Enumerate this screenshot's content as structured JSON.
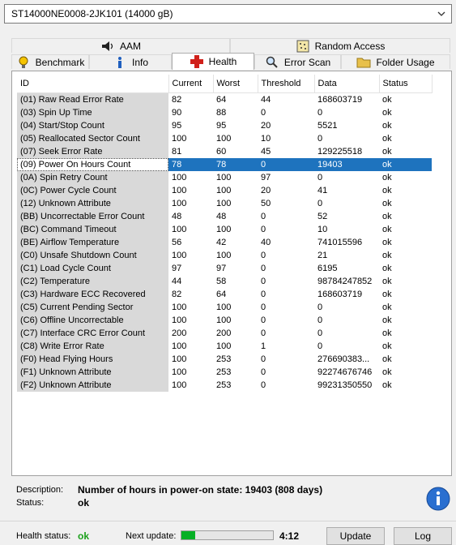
{
  "drive_select": {
    "value": "ST14000NE0008-2JK101 (14000 gB)"
  },
  "tabs_top": [
    {
      "label": "AAM",
      "icon": "speaker-icon"
    },
    {
      "label": "Random Access",
      "icon": "grid-icon"
    }
  ],
  "tabs_bottom": [
    {
      "label": "Benchmark",
      "icon": "lightbulb-icon"
    },
    {
      "label": "Info",
      "icon": "info-icon"
    },
    {
      "label": "Health",
      "icon": "red-cross-icon",
      "active": true
    },
    {
      "label": "Error Scan",
      "icon": "magnifier-icon"
    },
    {
      "label": "Folder Usage",
      "icon": "folder-icon"
    }
  ],
  "table": {
    "columns": [
      "ID",
      "Current",
      "Worst",
      "Threshold",
      "Data",
      "Status"
    ],
    "selected_index": 5,
    "rows": [
      [
        "(01) Raw Read Error Rate",
        "82",
        "64",
        "44",
        "168603719",
        "ok"
      ],
      [
        "(03) Spin Up Time",
        "90",
        "88",
        "0",
        "0",
        "ok"
      ],
      [
        "(04) Start/Stop Count",
        "95",
        "95",
        "20",
        "5521",
        "ok"
      ],
      [
        "(05) Reallocated Sector Count",
        "100",
        "100",
        "10",
        "0",
        "ok"
      ],
      [
        "(07) Seek Error Rate",
        "81",
        "60",
        "45",
        "129225518",
        "ok"
      ],
      [
        "(09) Power On Hours Count",
        "78",
        "78",
        "0",
        "19403",
        "ok"
      ],
      [
        "(0A) Spin Retry Count",
        "100",
        "100",
        "97",
        "0",
        "ok"
      ],
      [
        "(0C) Power Cycle Count",
        "100",
        "100",
        "20",
        "41",
        "ok"
      ],
      [
        "(12) Unknown Attribute",
        "100",
        "100",
        "50",
        "0",
        "ok"
      ],
      [
        "(BB) Uncorrectable Error Count",
        "48",
        "48",
        "0",
        "52",
        "ok"
      ],
      [
        "(BC) Command Timeout",
        "100",
        "100",
        "0",
        "10",
        "ok"
      ],
      [
        "(BE) Airflow Temperature",
        "56",
        "42",
        "40",
        "741015596",
        "ok"
      ],
      [
        "(C0) Unsafe Shutdown Count",
        "100",
        "100",
        "0",
        "21",
        "ok"
      ],
      [
        "(C1) Load Cycle Count",
        "97",
        "97",
        "0",
        "6195",
        "ok"
      ],
      [
        "(C2) Temperature",
        "44",
        "58",
        "0",
        "98784247852",
        "ok"
      ],
      [
        "(C3) Hardware ECC Recovered",
        "82",
        "64",
        "0",
        "168603719",
        "ok"
      ],
      [
        "(C5) Current Pending Sector",
        "100",
        "100",
        "0",
        "0",
        "ok"
      ],
      [
        "(C6) Offline Uncorrectable",
        "100",
        "100",
        "0",
        "0",
        "ok"
      ],
      [
        "(C7) Interface CRC Error Count",
        "200",
        "200",
        "0",
        "0",
        "ok"
      ],
      [
        "(C8) Write Error Rate",
        "100",
        "100",
        "1",
        "0",
        "ok"
      ],
      [
        "(F0) Head Flying Hours",
        "100",
        "253",
        "0",
        "276690383...",
        "ok"
      ],
      [
        "(F1) Unknown Attribute",
        "100",
        "253",
        "0",
        "92274676746",
        "ok"
      ],
      [
        "(F2) Unknown Attribute",
        "100",
        "253",
        "0",
        "99231350550",
        "ok"
      ]
    ]
  },
  "details": {
    "description_label": "Description:",
    "description_value": "Number of hours in power-on state: 19403 (808 days)",
    "status_label": "Status:",
    "status_value": "ok"
  },
  "footer": {
    "health_label": "Health status:",
    "health_value": "ok",
    "next_update_label": "Next update:",
    "progress_fraction": 0.15,
    "timer": "4:12",
    "update_button": "Update",
    "log_button": "Log"
  },
  "colors": {
    "selection": "#1e73be",
    "ok_green": "#1aa01a",
    "progress_green": "#06b025"
  }
}
